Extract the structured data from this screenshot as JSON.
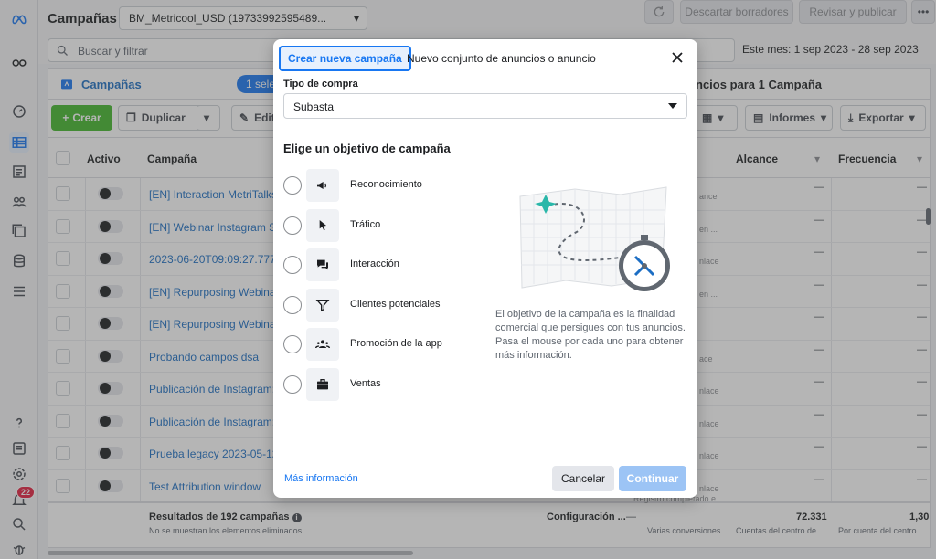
{
  "topbar": {
    "title": "Campañas",
    "account": "BM_Metricool_USD (19733992595489...",
    "discard_label": "Descartar borradores",
    "review_label": "Revisar y publicar",
    "more_label": "•••"
  },
  "search": {
    "placeholder": "Buscar y filtrar",
    "date_range": "Este mes: 1 sep 2023 - 28 sep 2023"
  },
  "tabs": {
    "campaigns": "Campañas",
    "selected_pill": "1 selec",
    "ads_for": "ncios para 1 Campaña"
  },
  "toolbar": {
    "create": "Crear",
    "duplicate": "Duplicar",
    "edit": "Edit",
    "reports": "Informes",
    "export": "Exportar"
  },
  "table": {
    "headers": {
      "active": "Activo",
      "campaign": "Campaña",
      "reach": "Alcance",
      "frequency": "Frecuencia"
    },
    "rows": [
      {
        "name": "[EN] Interaction MetriTalks",
        "sub": "ance"
      },
      {
        "name": "[EN] Webinar Instagram Stor",
        "sub": "en ..."
      },
      {
        "name": "2023-06-20T09:09:27.77785",
        "sub": "nlace"
      },
      {
        "name": "[EN] Repurposing Webinar - L",
        "sub": "en ..."
      },
      {
        "name": "[EN] Repurposing Webinar - L",
        "sub": ""
      },
      {
        "name": "Probando campos dsa",
        "sub": "ace"
      },
      {
        "name": "Publicación de Instagram: 🥂",
        "sub": "nlace"
      },
      {
        "name": "Publicación de Instagram: 🕵",
        "sub": "nlace"
      },
      {
        "name": "Prueba legacy 2023-05-12 17",
        "sub": "nlace"
      },
      {
        "name": "Test Attribution window",
        "sub": "nlace"
      }
    ],
    "dash": "—",
    "footer": {
      "results": "Resultados de 192 campañas",
      "note": "No se muestran los elementos eliminados",
      "config": "Configuración ...",
      "conversions_dash": "—",
      "conversions_sub": "Varias conversiones",
      "reach_total": "72.331",
      "reach_sub": "Cuentas del centro de ...",
      "freq_total": "1,30",
      "freq_sub": "Por cuenta del centro ...",
      "registro": "Registro completado e"
    }
  },
  "rail": {
    "notifications": "22"
  },
  "modal": {
    "tab_new": "Crear nueva campaña",
    "tab_existing": "Nuevo conjunto de anuncios o anuncio",
    "purchase_label": "Tipo de compra",
    "purchase_value": "Subasta",
    "heading": "Elige un objetivo de campaña",
    "objectives": [
      {
        "label": "Reconocimiento",
        "icon": "megaphone-icon"
      },
      {
        "label": "Tráfico",
        "icon": "cursor-icon"
      },
      {
        "label": "Interacción",
        "icon": "chat-icon"
      },
      {
        "label": "Clientes potenciales",
        "icon": "funnel-icon"
      },
      {
        "label": "Promoción de la app",
        "icon": "people-icon"
      },
      {
        "label": "Ventas",
        "icon": "briefcase-icon"
      }
    ],
    "description": "El objetivo de la campaña es la finalidad comercial que persigues con tus anuncios. Pasa el mouse por cada uno para obtener más información.",
    "more_info": "Más información",
    "cancel": "Cancelar",
    "continue": "Continuar"
  }
}
